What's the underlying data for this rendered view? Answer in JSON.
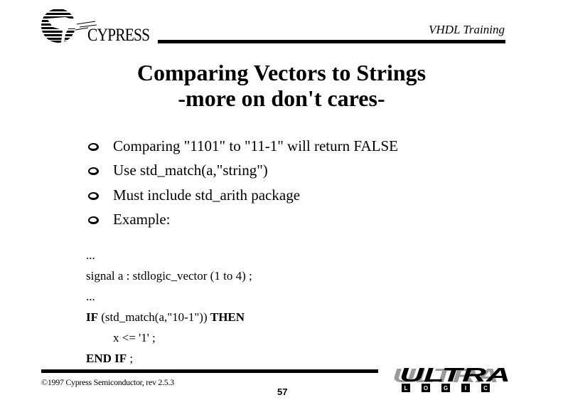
{
  "header": {
    "brand": "CYPRESS",
    "course_title": "VHDL Training",
    "logo_icon": "cypress-tree-logo-icon"
  },
  "slide": {
    "title_line1": "Comparing Vectors to Strings",
    "title_line2": "-more on don't cares-",
    "bullet_icon": "hollow-circle-bullet-icon",
    "bullets": [
      {
        "text": "Comparing \"1101\" to \"11-1\" will return FALSE"
      },
      {
        "text": "Use std_match(a,\"string\")"
      },
      {
        "text": "Must include std_arith package"
      },
      {
        "text": "Example:"
      }
    ],
    "code": {
      "line1": "...",
      "line2": "signal a : stdlogic_vector (1 to 4) ;",
      "line3": "...",
      "line4_kw1": "IF",
      "line4_mid": " (std_match(a,\"10-1\")) ",
      "line4_kw2": "THEN",
      "line5": "x <= '1' ;",
      "line6_kw": "END IF",
      "line6_rest": " ;"
    }
  },
  "footer": {
    "copyright": "©1997 Cypress Semiconductor, rev 2.5.3",
    "page_number": "57",
    "logo": {
      "word": "ULTRA",
      "sub_letters": [
        "L",
        "O",
        "G",
        "I",
        "C"
      ],
      "icon": "ultralogic-logo-icon"
    }
  }
}
